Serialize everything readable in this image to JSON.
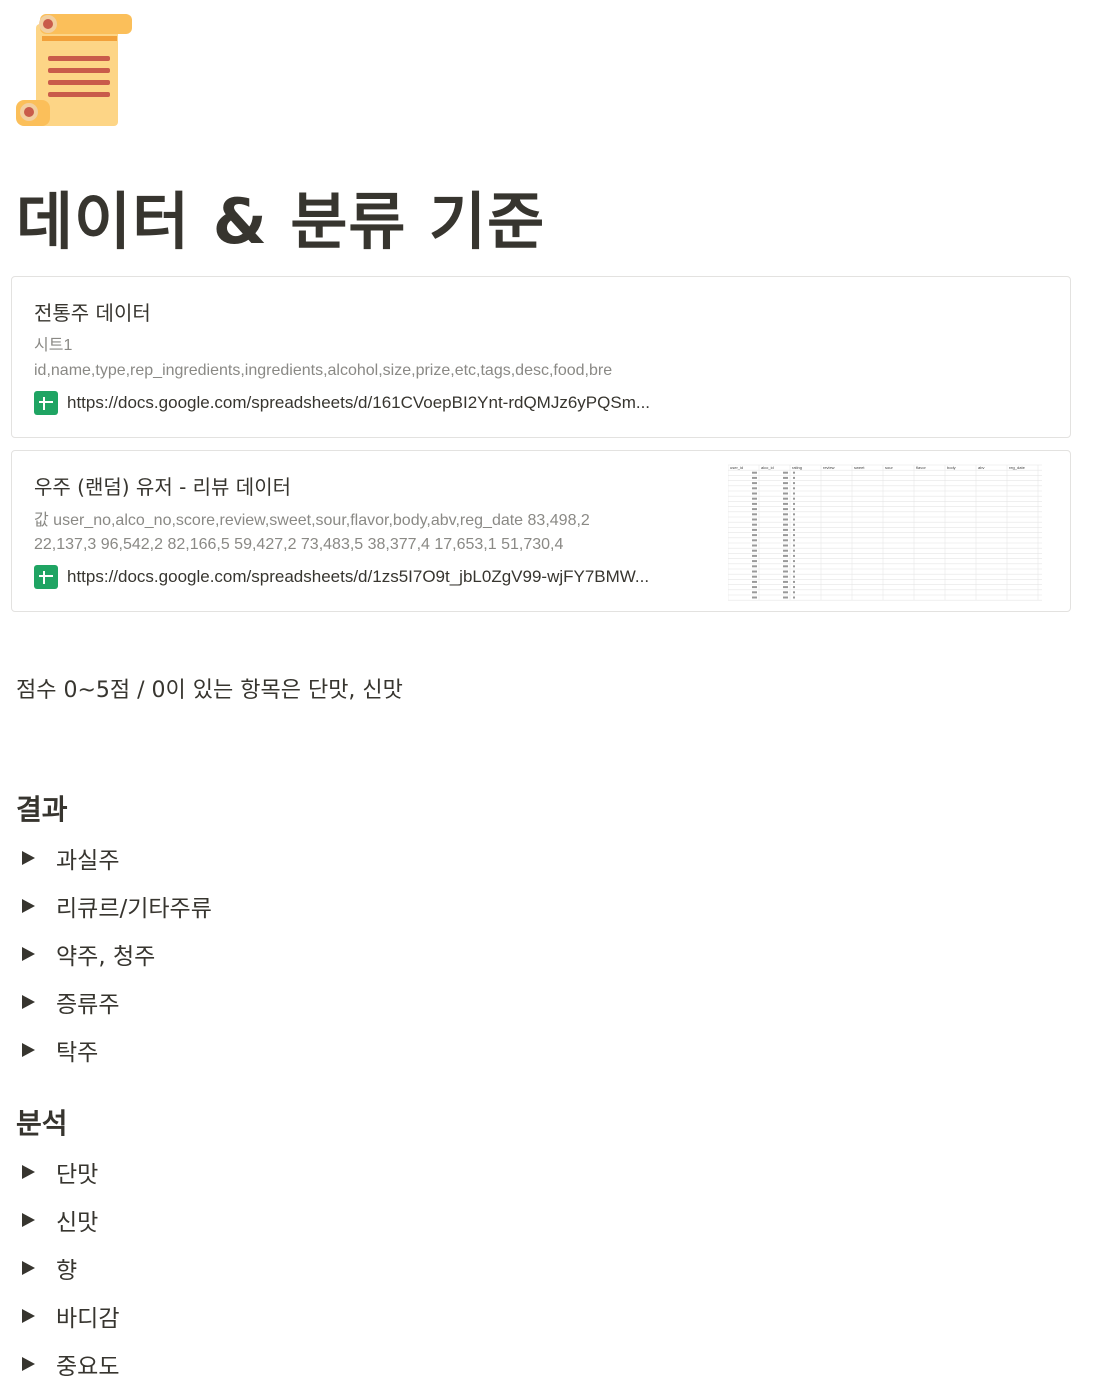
{
  "page": {
    "icon": "scroll-icon",
    "title": "데이터 & 분류 기준"
  },
  "bookmarks": [
    {
      "title": "전통주 데이터",
      "desc_line1": "시트1",
      "desc_line2": "id,name,type,rep_ingredients,ingredients,alcohol,size,prize,etc,tags,desc,food,bre",
      "url": "https://docs.google.com/spreadsheets/d/161CVoepBI2Ynt-rdQMJz6yPQSm...",
      "icon": "google-sheets-icon"
    },
    {
      "title": "우주 (랜덤) 유저 - 리뷰 데이터",
      "desc_line1": "값 user_no,alco_no,score,review,sweet,sour,flavor,body,abv,reg_date 83,498,2",
      "desc_line2": "22,137,3 96,542,2 82,166,5 59,427,2 73,483,5 38,377,4 17,653,1 51,730,4",
      "url": "https://docs.google.com/spreadsheets/d/1zs5I7O9t_jbL0ZgV99-wjFY7BMW...",
      "icon": "google-sheets-icon",
      "thumbnail_headers": [
        "user_id",
        "alco_id",
        "rating",
        "review",
        "sweet",
        "sour",
        "flavor",
        "body",
        "abv",
        "reg_date"
      ]
    }
  ],
  "note": "점수 0~5점 / 0이 있는 항목은 단맛, 신맛",
  "sections": {
    "result": {
      "heading": "결과",
      "toggles": [
        "과실주",
        "리큐르/기타주류",
        "약주, 청주",
        "증류주",
        "탁주"
      ]
    },
    "analysis": {
      "heading": "분석",
      "toggles": [
        "단맛",
        "신맛",
        "향",
        "바디감",
        "중요도"
      ]
    }
  }
}
